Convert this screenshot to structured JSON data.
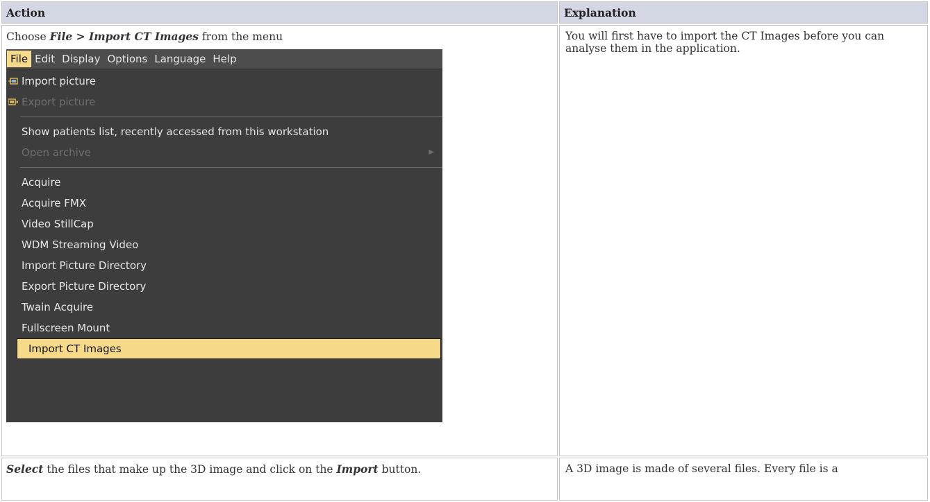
{
  "table": {
    "headers": [
      "Action",
      "Explanation"
    ],
    "row1": {
      "action_parts": [
        "Choose ",
        "File",
        " > ",
        "Import CT Images",
        " from the menu"
      ],
      "explanation": "You will first have to import the CT Images before you can analyse them in the application."
    },
    "row2": {
      "action_parts": [
        "Select",
        " the files that make up the 3D image and click on the ",
        "Import",
        " button."
      ],
      "explanation": "A 3D image is made of several files. Every file is a"
    }
  },
  "menu_screenshot": {
    "menubar": [
      "File",
      "Edit",
      "Display",
      "Options",
      "Language",
      "Help"
    ],
    "items": {
      "import_picture": "Import picture",
      "export_picture": "Export picture",
      "show_patients": "Show patients list, recently accessed from this workstation",
      "open_archive": "Open archive",
      "acquire": "Acquire",
      "acquire_fmx": "Acquire FMX",
      "video_stillcap": "Video StillCap",
      "wdm_streaming": "WDM Streaming Video",
      "import_picture_directory": "Import Picture Directory",
      "export_picture_directory": "Export Picture Directory",
      "twain_acquire": "Twain Acquire",
      "fullscreen_mount": "Fullscreen Mount",
      "import_ct_images": "Import CT Images"
    },
    "colors": {
      "highlight": "#f7d98a",
      "menu_bg": "#3d3d3d",
      "disabled": "#6e6e6e"
    }
  }
}
